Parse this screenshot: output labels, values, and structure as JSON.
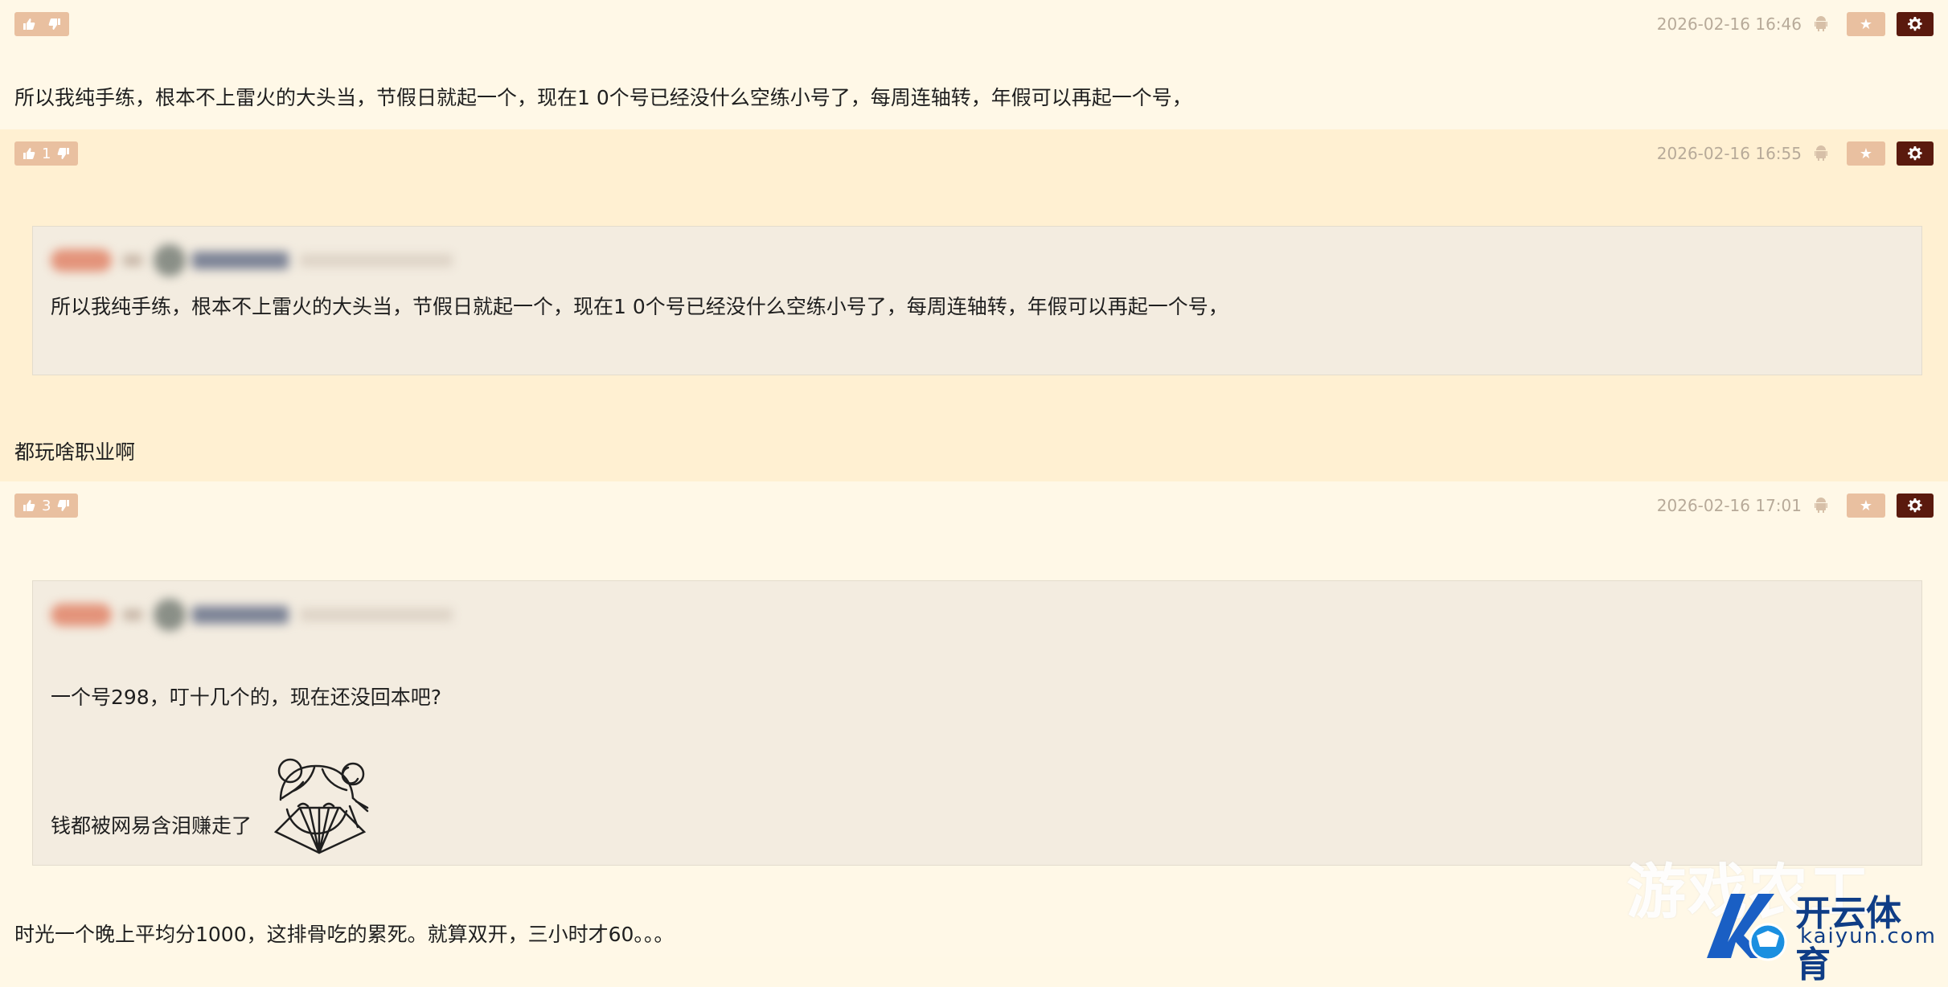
{
  "posts": [
    {
      "likes": "",
      "date": "2026-02-16 16:46",
      "body": "所以我纯手练，根本不上雷火的大头当，节假日就起一个，现在1 0个号已经没什么空练小号了，每周连轴转，年假可以再起一个号，"
    },
    {
      "likes": "1",
      "date": "2026-02-16 16:55",
      "quote": "所以我纯手练，根本不上雷火的大头当，节假日就起一个，现在1 0个号已经没什么空练小号了，每周连轴转，年假可以再起一个号，",
      "body": "都玩啥职业啊"
    },
    {
      "likes": "3",
      "date": "2026-02-16 17:01",
      "quote_line1": "一个号298，叮十几个的，现在还没回本吧?",
      "quote_line2": "钱都被网易含泪赚走了",
      "body": "时光一个晚上平均分1000，这排骨吃的累死。就算双开，三小时才60。。。"
    }
  ],
  "icons": {
    "like": "thumbs-up-icon",
    "dislike": "thumbs-down-icon",
    "device": "android-icon",
    "favorite": "star-icon",
    "settings": "gear-icon"
  },
  "watermark": {
    "big": "游戏农工",
    "brand": "开云体育",
    "domain": "kaiyun.com"
  },
  "colors": {
    "background": "#fff8e6",
    "highlight": "#fff0d2",
    "button": "#e9c0a0",
    "settings_button": "#5a1a0e",
    "quote_bg": "#f3ece0"
  }
}
